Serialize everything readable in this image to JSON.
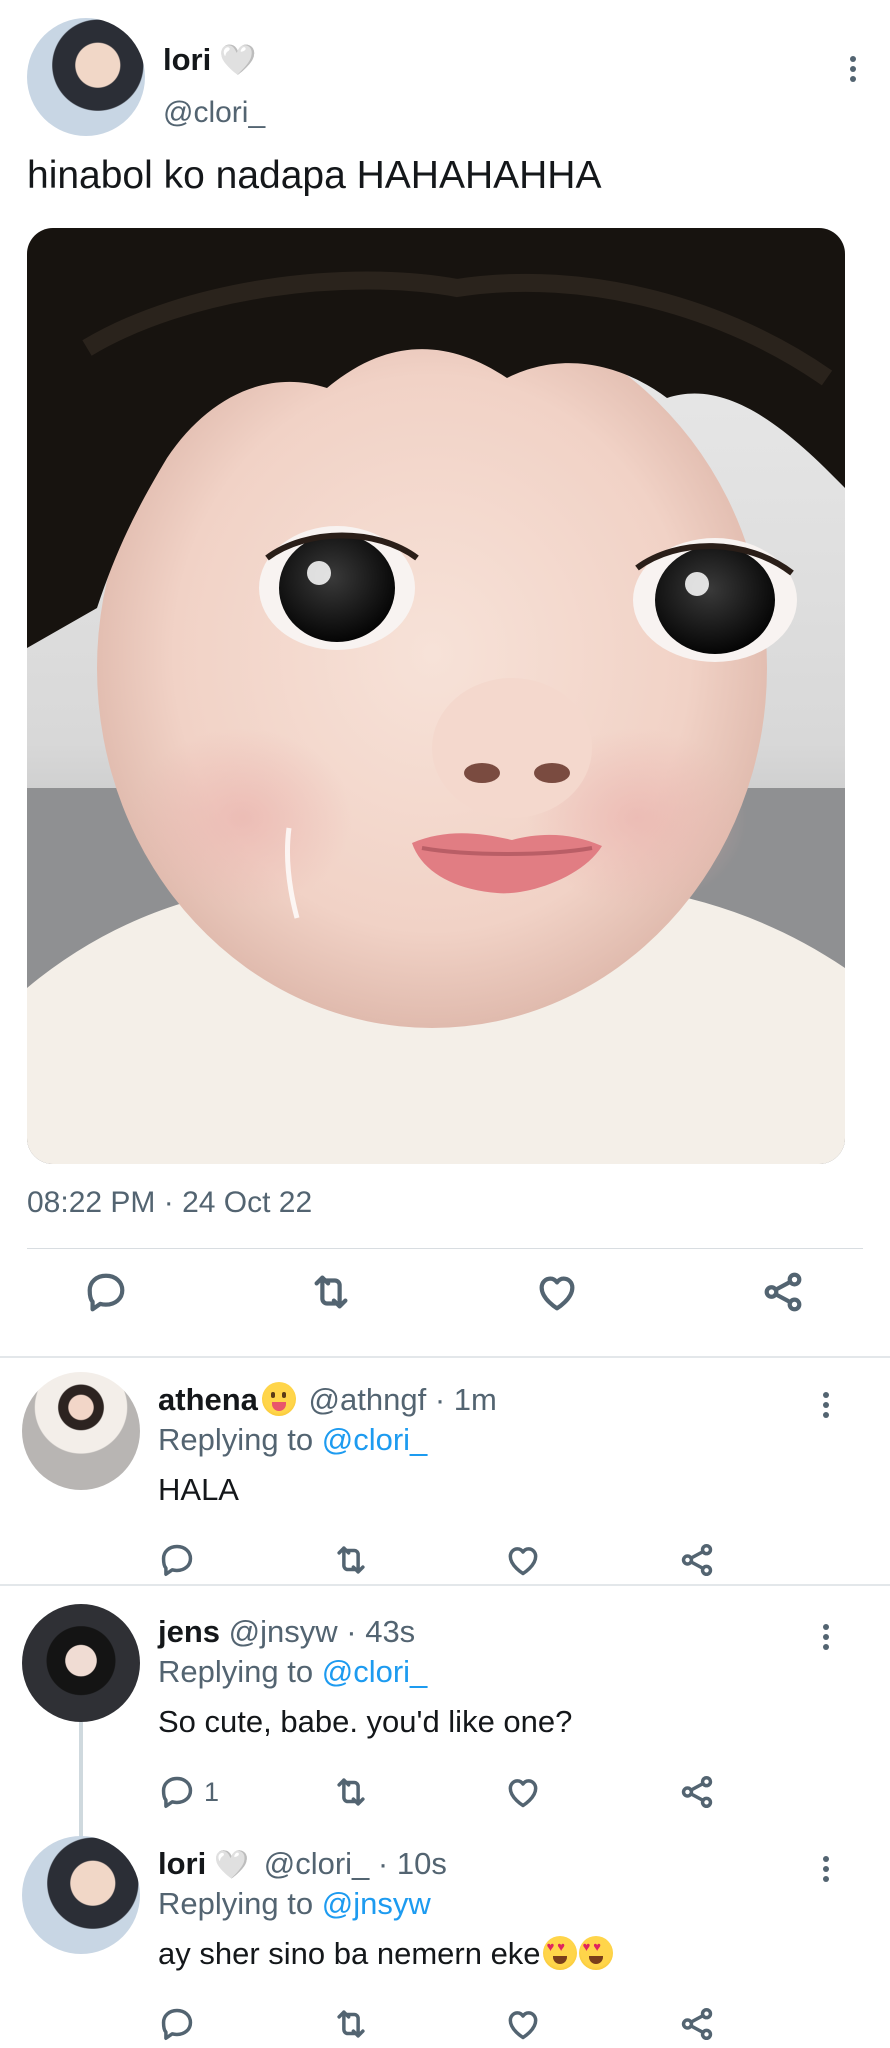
{
  "main_tweet": {
    "name": "lori",
    "name_emoji": "🤍",
    "handle": "@clori_",
    "text": "hinabol ko nadapa HAHAHAHHA",
    "timestamp": "08:22 PM · 24 Oct 22"
  },
  "replies": [
    {
      "name": "athena",
      "handle": "@athngf",
      "time": "· 1m",
      "replying_prefix": "Replying to ",
      "replying_to": "@clori_",
      "text": "HALA",
      "reply_count": ""
    },
    {
      "name": "jens",
      "handle": "@jnsyw",
      "time": "· 43s",
      "replying_prefix": "Replying to ",
      "replying_to": "@clori_",
      "text": "So cute, babe. you'd like one?",
      "reply_count": "1"
    },
    {
      "name": "lori",
      "handle": "@clori_",
      "time": "· 10s",
      "replying_prefix": "Replying to ",
      "replying_to": "@jnsyw",
      "text": "ay sher sino ba nemern eke",
      "reply_count": ""
    }
  ],
  "icons": [
    "reply-icon",
    "retweet-icon",
    "like-icon",
    "share-icon",
    "more-icon"
  ],
  "colors": {
    "link": "#1d9bf0",
    "muted": "#536471",
    "text": "#14171a"
  }
}
